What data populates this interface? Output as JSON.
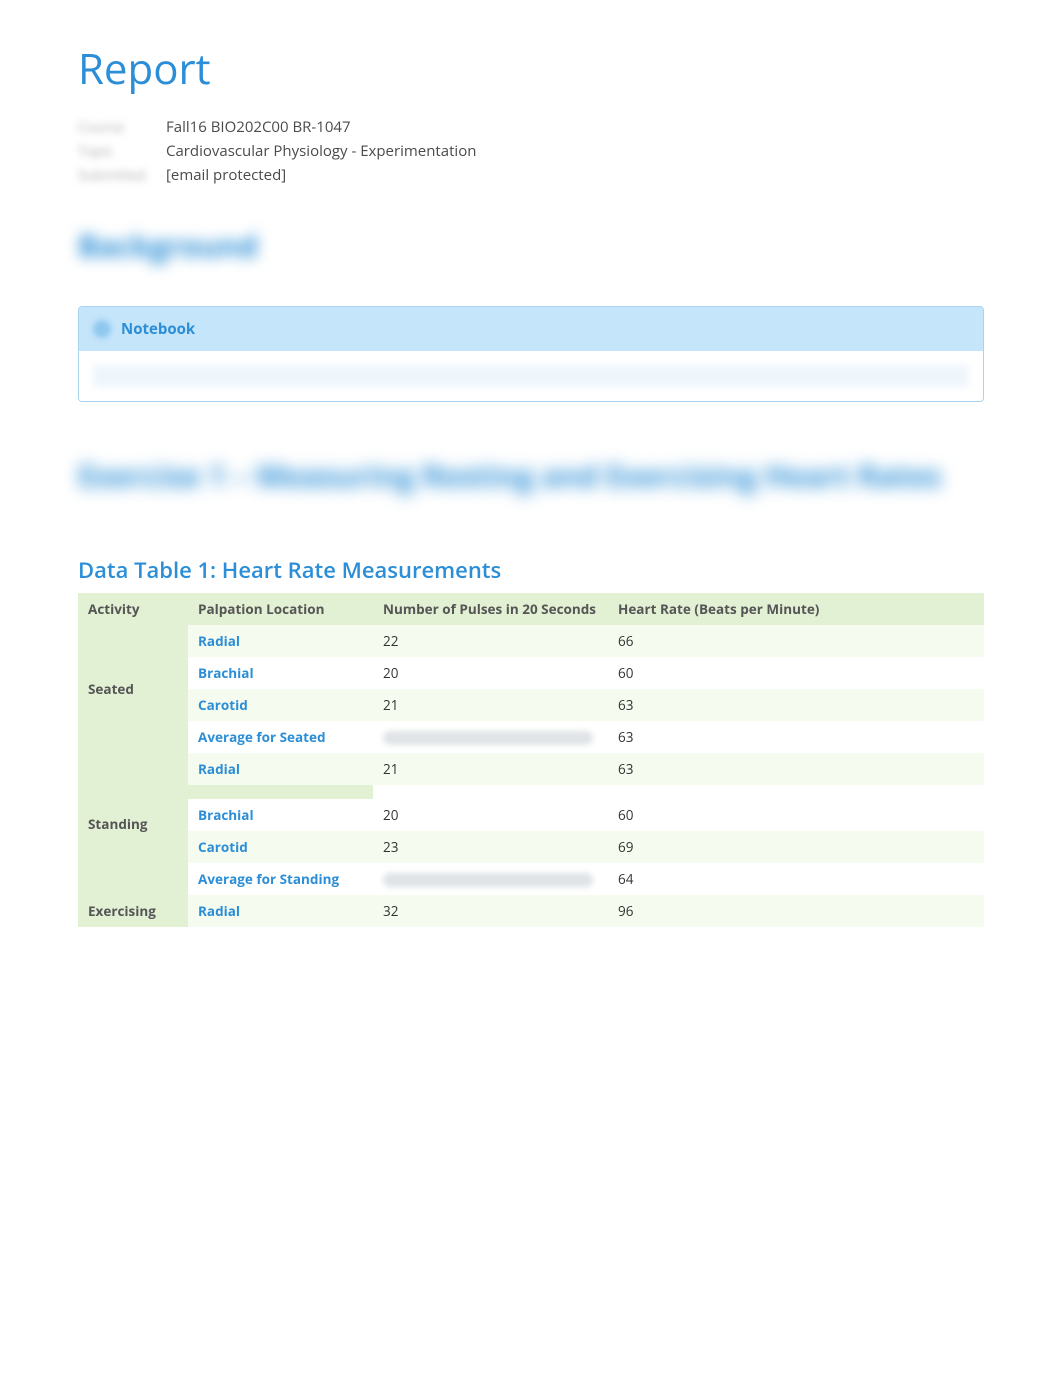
{
  "title": "Report",
  "meta": {
    "label1": "Course",
    "value1": "Fall16 BIO202C00 BR-1047",
    "label2": "Topic",
    "value2": "Cardiovascular Physiology - Experimentation",
    "label3": "Submitted",
    "value3": "[email protected]"
  },
  "background_heading": "Background",
  "notebook": {
    "title": "Notebook"
  },
  "exercise_heading": "Exercise 1 – Measuring Resting and Exercising Heart Rates",
  "table": {
    "title": "Data Table 1: Heart Rate Measurements",
    "headers": {
      "activity": "Activity",
      "palpation": "Palpation Location",
      "pulses": "Number of Pulses in 20 Seconds",
      "heartrate": "Heart Rate (Beats per Minute)"
    },
    "groups": [
      {
        "activity": "Seated",
        "rows": [
          {
            "palpation": "Radial",
            "pulses": "22",
            "hr": "66"
          },
          {
            "palpation": "Brachial",
            "pulses": "20",
            "hr": "60"
          },
          {
            "palpation": "Carotid",
            "pulses": "21",
            "hr": "63"
          },
          {
            "palpation": "Average for Seated",
            "pulses": "",
            "hr": "63",
            "redacted": true
          }
        ]
      },
      {
        "activity": "Standing",
        "rows": [
          {
            "palpation": "Radial",
            "pulses": "21",
            "hr": "63"
          },
          {
            "palpation": "Brachial",
            "pulses": "20",
            "hr": "60",
            "spacer_before": true
          },
          {
            "palpation": "Carotid",
            "pulses": "23",
            "hr": "69"
          },
          {
            "palpation": "Average for Standing",
            "pulses": "",
            "hr": "64",
            "redacted": true
          }
        ]
      },
      {
        "activity": "Exercising",
        "rows": [
          {
            "palpation": "Radial",
            "pulses": "32",
            "hr": "96"
          }
        ]
      }
    ]
  }
}
